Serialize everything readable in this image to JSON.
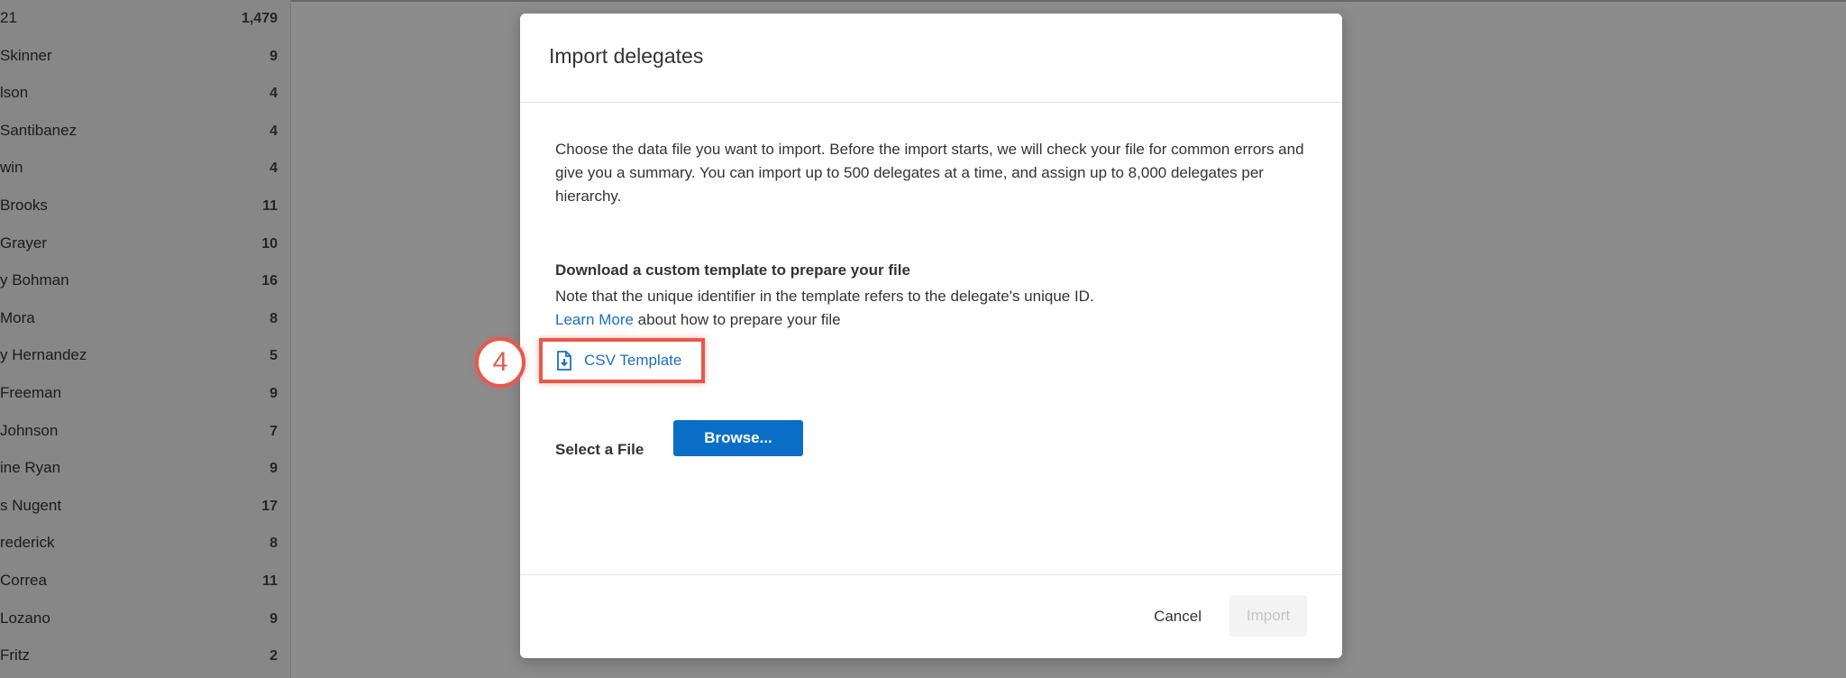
{
  "background_list": {
    "rows": [
      {
        "name": "21",
        "count": "1,479"
      },
      {
        "name": "Skinner",
        "count": "9"
      },
      {
        "name": "lson",
        "count": "4"
      },
      {
        "name": "Santibanez",
        "count": "4"
      },
      {
        "name": "win",
        "count": "4"
      },
      {
        "name": "Brooks",
        "count": "11"
      },
      {
        "name": "Grayer",
        "count": "10"
      },
      {
        "name": "y Bohman",
        "count": "16"
      },
      {
        "name": "Mora",
        "count": "8"
      },
      {
        "name": "y Hernandez",
        "count": "5"
      },
      {
        "name": "Freeman",
        "count": "9"
      },
      {
        "name": "Johnson",
        "count": "7"
      },
      {
        "name": "ine Ryan",
        "count": "9"
      },
      {
        "name": "s Nugent",
        "count": "17"
      },
      {
        "name": "rederick",
        "count": "8"
      },
      {
        "name": "Correa",
        "count": "11"
      },
      {
        "name": "Lozano",
        "count": "9"
      },
      {
        "name": "Fritz",
        "count": "2"
      }
    ]
  },
  "modal": {
    "title": "Import delegates",
    "description": "Choose the data file you want to import. Before the import starts, we will check your file for common errors and give you a summary. You can import up to 500 delegates at a time, and assign up to 8,000 delegates per hierarchy.",
    "template_heading": "Download a custom template to prepare your file",
    "template_note_before": "Note that the unique identifier in the template refers to the delegate's unique ID.",
    "learn_more_link": "Learn More",
    "template_note_after": "about how to prepare your file",
    "csv_template_label": "CSV Template",
    "csv_icon": "file-download-icon",
    "step_number": "4",
    "select_file_label": "Select a File",
    "browse_label": "Browse...",
    "cancel_label": "Cancel",
    "import_label": "Import"
  },
  "colors": {
    "accent": "#0a6ec7",
    "link": "#1a6fc4",
    "highlight": "#e8584d"
  }
}
